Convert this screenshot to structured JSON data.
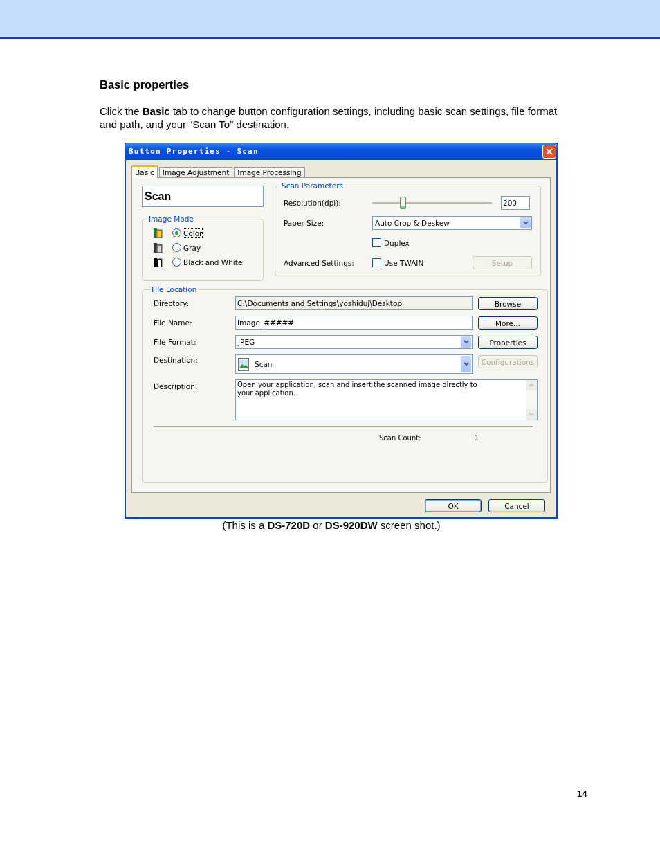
{
  "heading": "Basic properties",
  "intro": "Click the **Basic** tab to change button configuration settings, including basic scan settings, file format and path, and your “Scan To” destination.",
  "dialog": {
    "title": "Button Properties - Scan",
    "tabs": [
      {
        "label": "Basic",
        "selected": true
      },
      {
        "label": "Image Adjustment",
        "selected": false
      },
      {
        "label": "Image Processing",
        "selected": false
      }
    ],
    "profile_name": "Scan",
    "image_mode": {
      "label": "Image Mode",
      "options": [
        {
          "label": "Color",
          "kind": "color",
          "selected": true
        },
        {
          "label": "Gray",
          "kind": "gray",
          "selected": false
        },
        {
          "label": "Black and White",
          "kind": "bw",
          "selected": false
        }
      ]
    },
    "scan_parameters": {
      "label": "Scan Parameters",
      "resolution": {
        "label": "Resolution(dpi):",
        "level": 0.26,
        "value": "200"
      },
      "paper_size": {
        "label": "Paper Size:",
        "value": "Auto Crop & Deskew"
      },
      "duplex": {
        "label": "Duplex",
        "checked": false
      },
      "advanced": {
        "label": "Advanced Settings:",
        "use_twain": {
          "label": "Use TWAIN",
          "checked": false
        },
        "setup_button": {
          "label": "Setup",
          "disabled": true
        }
      }
    },
    "file_location": {
      "label": "File Location",
      "rows": [
        {
          "label": "Directory:",
          "kind": "readonly",
          "value": "C:\\Documents and Settings\\yoshiduj\\Desktop",
          "button": {
            "label": "Browse",
            "disabled": false
          }
        },
        {
          "label": "File Name:",
          "kind": "text",
          "value": "Image_#####",
          "button": {
            "label": "More...",
            "disabled": false
          }
        },
        {
          "label": "File Format:",
          "kind": "dropdown",
          "value": "JPEG",
          "button": {
            "label": "Properties",
            "disabled": false
          }
        },
        {
          "label": "Destination:",
          "kind": "destination",
          "value": "Scan",
          "button": {
            "label": "Configurations",
            "disabled": true
          }
        }
      ],
      "description": {
        "label": "Description:",
        "value": "Open your application, scan and insert the scanned image directly to your application."
      },
      "scan_count": {
        "label": "Scan Count:",
        "value": "1"
      }
    },
    "buttons": [
      {
        "label": "OK",
        "default": true
      },
      {
        "label": "Cancel",
        "default": false
      }
    ]
  },
  "caption": "(This is a **DS-720D** or **DS-920DW** screen shot.)",
  "page_number": "14"
}
